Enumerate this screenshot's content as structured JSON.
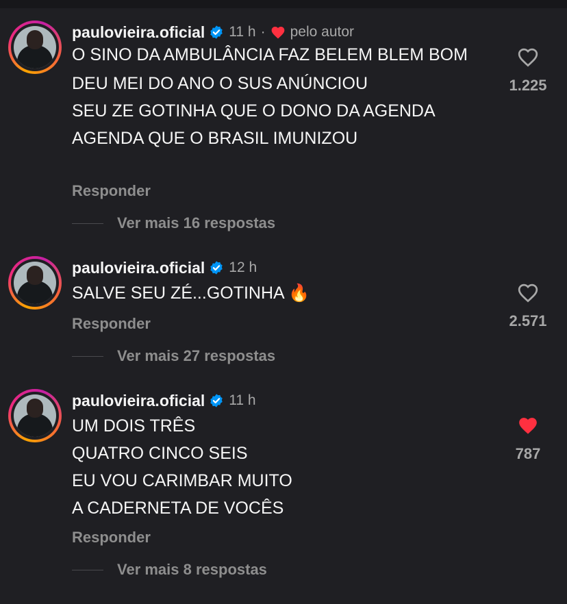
{
  "comments": [
    {
      "username": "paulovieira.oficial",
      "time": "11 h",
      "author_label": "pelo autor",
      "lines": [
        "O SINO DA AMBULÂNCIA FAZ BELEM BLEM BOM",
        "DEU MEI DO ANO O SUS ANÚNCIOU",
        "SEU ZE GOTINHA QUE O DONO DA AGENDA",
        "AGENDA QUE O BRASIL IMUNIZOU"
      ],
      "reply_label": "Responder",
      "view_replies": "Ver mais 16 respostas",
      "likes": "1.225",
      "liked": false
    },
    {
      "username": "paulovieira.oficial",
      "time": "12 h",
      "lines": [
        "SALVE SEU ZÉ...GOTINHA 🔥"
      ],
      "reply_label": "Responder",
      "view_replies": "Ver mais 27 respostas",
      "likes": "2.571",
      "liked": false
    },
    {
      "username": "paulovieira.oficial",
      "time": "11 h",
      "lines": [
        "UM DOIS TRÊS",
        "QUATRO CINCO SEIS",
        "EU VOU CARIMBAR MUITO",
        "A CADERNETA DE VOCÊS"
      ],
      "reply_label": "Responder",
      "view_replies": "Ver mais 8 respostas",
      "likes": "787",
      "liked": true
    }
  ],
  "colors": {
    "background": "#1f1f23",
    "verified": "#0095f6",
    "liked_heart": "#ff3040",
    "muted_text": "#a8a8a8"
  }
}
